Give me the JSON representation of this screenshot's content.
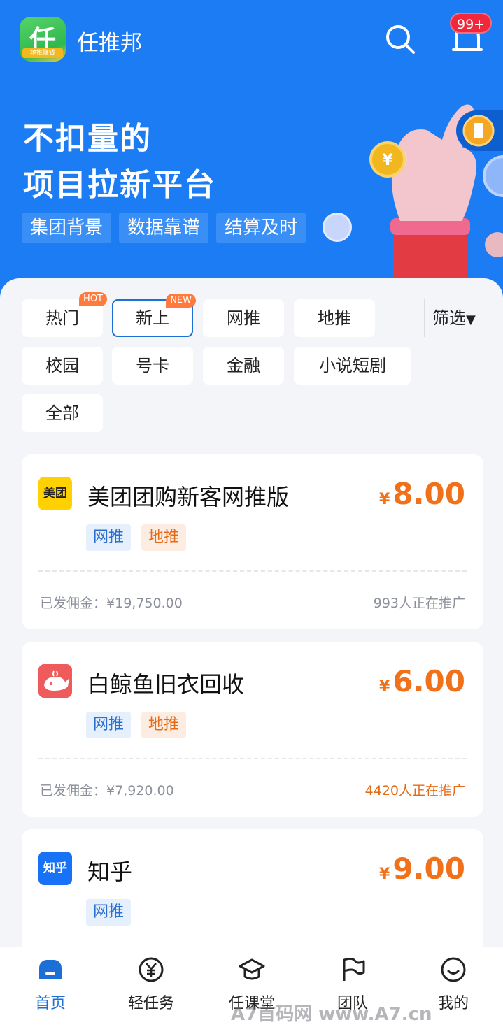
{
  "header": {
    "logo_char": "任",
    "logo_sub": "地推赚钱",
    "app_name": "任推邦",
    "notification_badge": "99+"
  },
  "banner": {
    "slogan_line1": "不扣量的",
    "slogan_line2": "项目拉新平台",
    "features": [
      "集团背景",
      "数据靠谱",
      "结算及时"
    ],
    "coin_symbol": "¥"
  },
  "categories": {
    "items": [
      {
        "label": "热门",
        "badge": "HOT"
      },
      {
        "label": "新上",
        "badge": "NEW",
        "selected": true
      },
      {
        "label": "网推"
      },
      {
        "label": "地推"
      },
      {
        "label": "校园"
      },
      {
        "label": "号卡"
      },
      {
        "label": "金融"
      },
      {
        "label": "小说短剧"
      },
      {
        "label": "全部"
      }
    ],
    "filter_label": "筛选",
    "filter_icon": "triangle-down-icon"
  },
  "tasks": [
    {
      "icon_text": "美团",
      "icon_bg": "#ffd100",
      "title": "美团团购新客网推版",
      "currency": "¥",
      "price": "8.00",
      "tags": [
        "网推",
        "地推"
      ],
      "paid_label": "已发佣金：",
      "paid_amount": "¥19,750.00",
      "promoters": "993人正在推广",
      "promoters_color": "#8a8f99"
    },
    {
      "icon_text": "",
      "icon_bg": "#ef5a5a",
      "title": "白鲸鱼旧衣回收",
      "currency": "¥",
      "price": "6.00",
      "tags": [
        "网推",
        "地推"
      ],
      "paid_label": "已发佣金：",
      "paid_amount": "¥7,920.00",
      "promoters": "4420人正在推广",
      "promoters_color": "#e56a18"
    },
    {
      "icon_text": "知乎",
      "icon_bg": "#1772f6",
      "title": "知乎",
      "currency": "¥",
      "price": "9.00",
      "tags": [
        "网推"
      ]
    }
  ],
  "tabbar": {
    "items": [
      {
        "label": "首页",
        "icon": "home-icon",
        "active": true
      },
      {
        "label": "轻任务",
        "icon": "yen-circle-icon"
      },
      {
        "label": "任课堂",
        "icon": "graduation-cap-icon"
      },
      {
        "label": "团队",
        "icon": "flag-icon"
      },
      {
        "label": "我的",
        "icon": "smile-icon"
      }
    ]
  },
  "watermark": "A7首码网 www.A7.cn",
  "colors": {
    "brand_blue": "#1c7cf4",
    "price_orange": "#f0711a",
    "active_tab": "#1c6fd6"
  }
}
